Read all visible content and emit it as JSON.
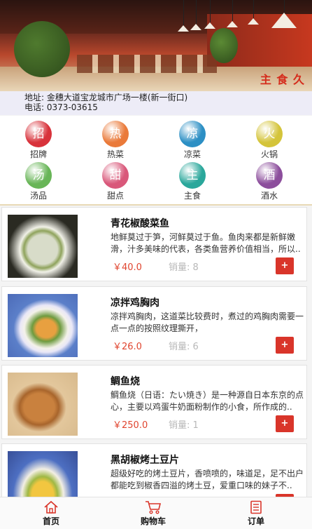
{
  "store": {
    "address": "地址: 金穗大道宝龙城市广场一楼(新一街口)",
    "phone": "电话: 0373-03615",
    "sign_text": "主 食 久"
  },
  "categories": [
    {
      "char": "招",
      "label": "招牌",
      "color": "#d8323b"
    },
    {
      "char": "热",
      "label": "热菜",
      "color": "#ea7a3a"
    },
    {
      "char": "凉",
      "label": "凉菜",
      "color": "#2c8fc4"
    },
    {
      "char": "火",
      "label": "火锅",
      "color": "#d4c43a"
    },
    {
      "char": "汤",
      "label": "汤品",
      "color": "#68b557"
    },
    {
      "char": "甜",
      "label": "甜点",
      "color": "#d9587a"
    },
    {
      "char": "主",
      "label": "主食",
      "color": "#2aa79b"
    },
    {
      "char": "酒",
      "label": "酒水",
      "color": "#8c4e9c"
    }
  ],
  "dishes": [
    {
      "name": "青花椒酸菜鱼",
      "desc": "地鲜莫过于笋，河鲜莫过于鱼。鱼肉来都是新鲜嫩滑，汁多美味的代表，各类鱼营养价值相当，所以..",
      "price": "￥40.0",
      "sales": "销量: 8",
      "add": "+"
    },
    {
      "name": "凉拌鸡胸肉",
      "desc": "凉拌鸡胸肉，这道菜比较费时，煮过的鸡胸肉需要一点一点的按照纹理撕开，",
      "price": "￥26.0",
      "sales": "销量: 6",
      "add": "+"
    },
    {
      "name": "鲷鱼烧",
      "desc": "鲷鱼烧（日语：たい焼き）是一种源自日本东京的点心，主要以鸡蛋牛奶面粉制作的小食，所作成的..",
      "price": "￥250.0",
      "sales": "销量: 1",
      "add": "+"
    },
    {
      "name": "黑胡椒烤土豆片",
      "desc": "超级好吃的烤土豆片，香喷喷的，味道足，足不出户都能吃到椒香四溢的烤土豆，爱重口味的妹子不..",
      "price": "",
      "sales": "",
      "add": "+"
    }
  ],
  "tabbar": {
    "home": "首页",
    "cart": "购物车",
    "orders": "订单"
  },
  "colors": {
    "accent": "#d9352a",
    "price": "#e0452f",
    "address_bg": "#edecf7"
  }
}
